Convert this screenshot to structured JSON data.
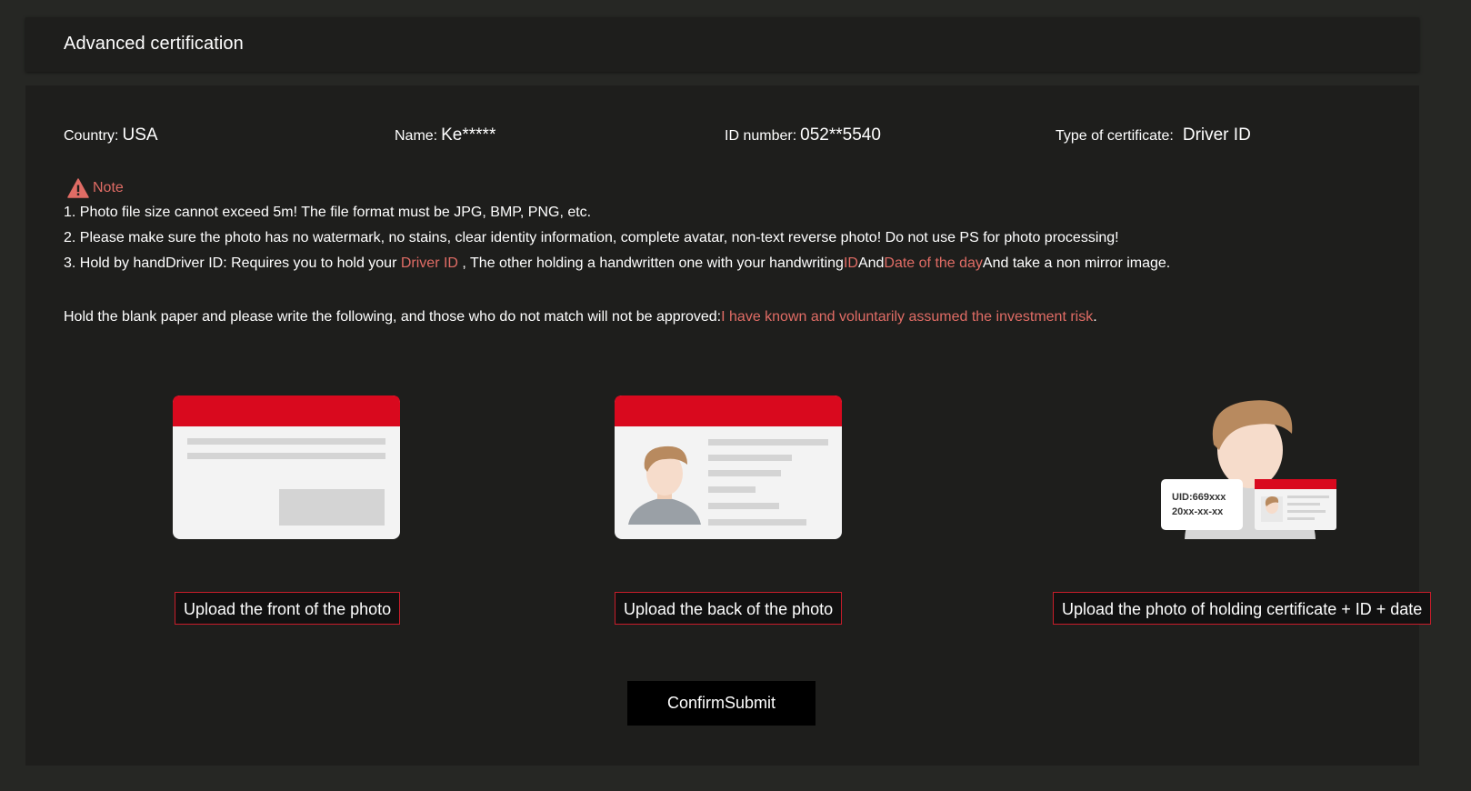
{
  "header": {
    "title": "Advanced certification"
  },
  "info": {
    "country_label": "Country:",
    "country_value": "USA",
    "name_label": "Name:",
    "name_value": "Ke*****",
    "id_label": "ID number:",
    "id_value": "052**5540",
    "type_label": "Type of certificate:",
    "type_value": "Driver ID"
  },
  "note": {
    "title": "Note",
    "line1": "1. Photo file size cannot exceed 5m! The file format must be JPG, BMP, PNG, etc.",
    "line2": "2. Please make sure the photo has no watermark, no stains, clear identity information, complete avatar, non-text reverse photo! Do not use PS for photo processing!",
    "line3_a": "3. Hold by handDriver ID: Requires you to hold your ",
    "line3_b": "Driver ID",
    "line3_c": " , The other holding a handwritten one with your handwriting",
    "line3_d": "ID",
    "line3_e": "And",
    "line3_f": "Date of the day",
    "line3_g": "And take a non mirror image."
  },
  "paper": {
    "text": "Hold the blank paper and please write the following, and those who do not match will not be approved:",
    "phrase": "I have known and voluntarily assumed the investment risk",
    "end": "."
  },
  "uploads": {
    "front_label": "Upload the front of the photo",
    "back_label": "Upload the back of the photo",
    "holding_label": "Upload the photo of holding certificate + ID + date",
    "holding_uid": "UID:669xxx",
    "holding_date": "20xx-xx-xx"
  },
  "actions": {
    "submit_label": "ConfirmSubmit"
  },
  "colors": {
    "accent_red": "#e06c65",
    "card_red": "#d9091e",
    "background": "#262724",
    "card": "#1e1e1c"
  }
}
